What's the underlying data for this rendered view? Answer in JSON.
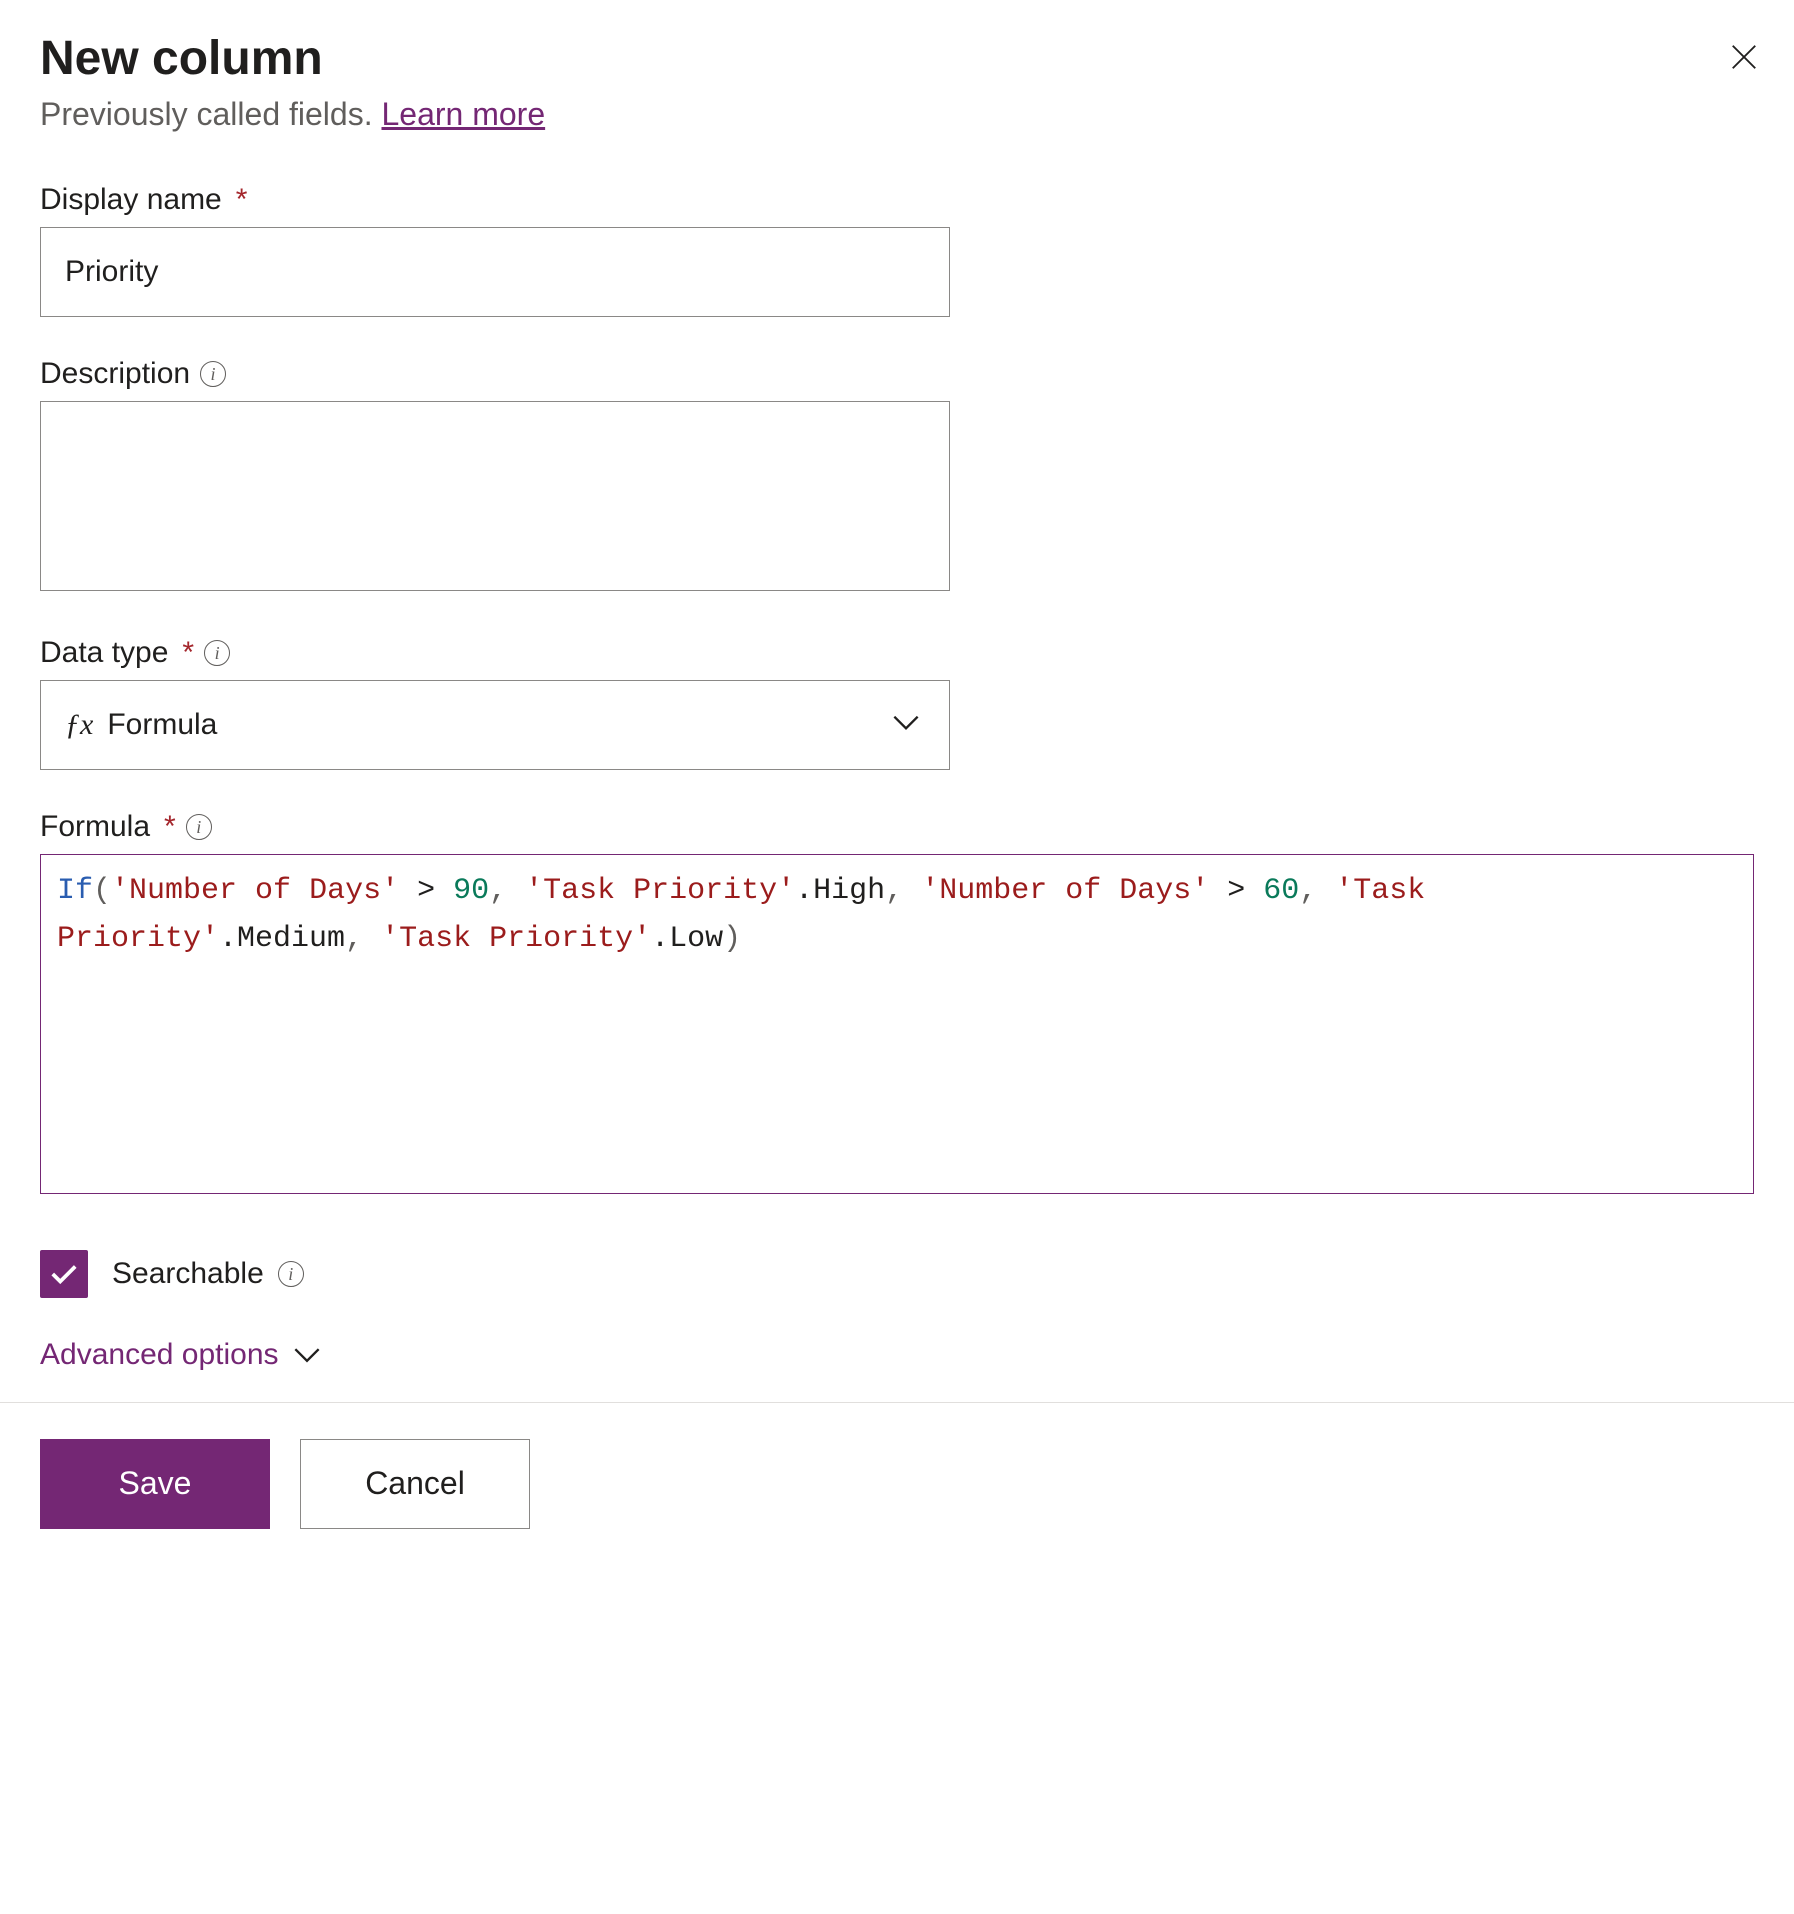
{
  "header": {
    "title": "New column",
    "subtitle_prefix": "Previously called fields. ",
    "learn_more": "Learn more"
  },
  "fields": {
    "display_name": {
      "label": "Display name",
      "value": "Priority"
    },
    "description": {
      "label": "Description",
      "value": ""
    },
    "data_type": {
      "label": "Data type",
      "value": "Formula"
    },
    "formula": {
      "label": "Formula",
      "tokens": [
        {
          "text": "If",
          "cls": "tk-fn"
        },
        {
          "text": "(",
          "cls": "tk-pnc"
        },
        {
          "text": "'Number of Days'",
          "cls": "tk-str"
        },
        {
          "text": " > ",
          "cls": "tk-op"
        },
        {
          "text": "90",
          "cls": "tk-num"
        },
        {
          "text": ", ",
          "cls": "tk-pnc"
        },
        {
          "text": "'Task Priority'",
          "cls": "tk-str"
        },
        {
          "text": ".High",
          "cls": "tk-id"
        },
        {
          "text": ", ",
          "cls": "tk-pnc"
        },
        {
          "text": "'Number of Days'",
          "cls": "tk-str"
        },
        {
          "text": " > ",
          "cls": "tk-op"
        },
        {
          "text": "60",
          "cls": "tk-num"
        },
        {
          "text": ", ",
          "cls": "tk-pnc"
        },
        {
          "text": "'Task Priority'",
          "cls": "tk-str"
        },
        {
          "text": ".Medium",
          "cls": "tk-id"
        },
        {
          "text": ", ",
          "cls": "tk-pnc"
        },
        {
          "text": "'Task Priority'",
          "cls": "tk-str"
        },
        {
          "text": ".Low",
          "cls": "tk-id"
        },
        {
          "text": ")",
          "cls": "tk-pnc"
        }
      ]
    },
    "searchable": {
      "label": "Searchable",
      "checked": true
    }
  },
  "advanced_options_label": "Advanced options",
  "footer": {
    "save": "Save",
    "cancel": "Cancel"
  }
}
